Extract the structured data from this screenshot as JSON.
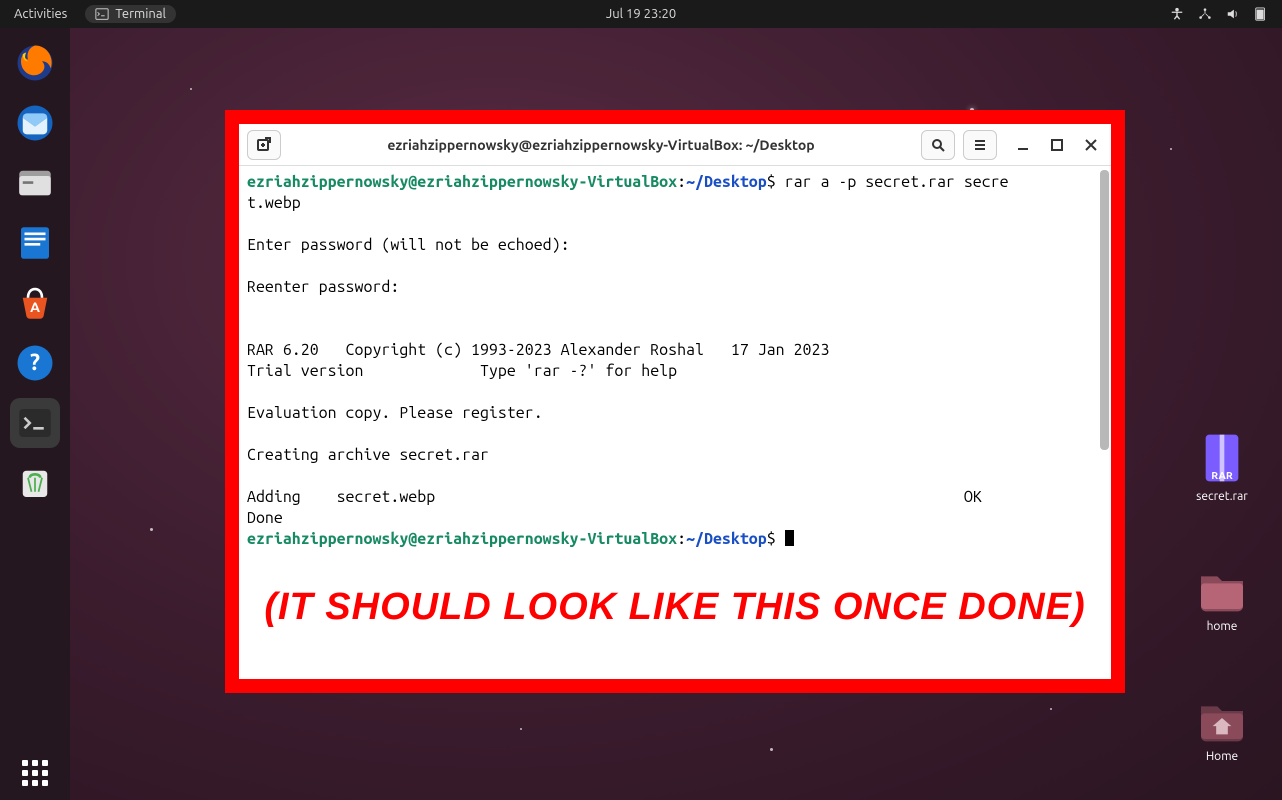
{
  "topbar": {
    "activities": "Activities",
    "app_name": "Terminal",
    "datetime": "Jul 19  23:20"
  },
  "dock": {
    "items": [
      {
        "name": "firefox"
      },
      {
        "name": "thunderbird"
      },
      {
        "name": "files"
      },
      {
        "name": "libreoffice-writer"
      },
      {
        "name": "software"
      },
      {
        "name": "help"
      },
      {
        "name": "terminal",
        "active": true
      },
      {
        "name": "trash"
      }
    ]
  },
  "desktop_icons": [
    {
      "label": "secret.rar",
      "kind": "rar"
    },
    {
      "label": "home",
      "kind": "folder"
    },
    {
      "label": "Home",
      "kind": "home"
    }
  ],
  "terminal": {
    "title": "ezriahzippernowsky@ezriahzippernowsky-VirtualBox: ~/Desktop",
    "prompt_user_host": "ezriahzippernowsky@ezriahzippernowsky-VirtualBox",
    "prompt_path": "~/Desktop",
    "prompt_sigil": "$",
    "command": "rar a -p secret.rar secret.webp",
    "lines": {
      "wrap_tail": "t.webp",
      "enter_pw": "Enter password (will not be echoed): ",
      "reenter_pw": "Reenter password: ",
      "rar_ver": "RAR 6.20   Copyright (c) 1993-2023 Alexander Roshal   17 Jan 2023",
      "trial": "Trial version             Type 'rar -?' for help",
      "eval": "Evaluation copy. Please register.",
      "creating": "Creating archive secret.rar",
      "adding": "Adding    secret.webp",
      "ok": "OK",
      "done": "Done"
    }
  },
  "caption": "(IT SHOULD LOOK LIKE THIS ONCE DONE)",
  "colors": {
    "frame_red": "#ff0000",
    "prompt_green": "#178a63",
    "prompt_blue": "#1a4fc4"
  }
}
